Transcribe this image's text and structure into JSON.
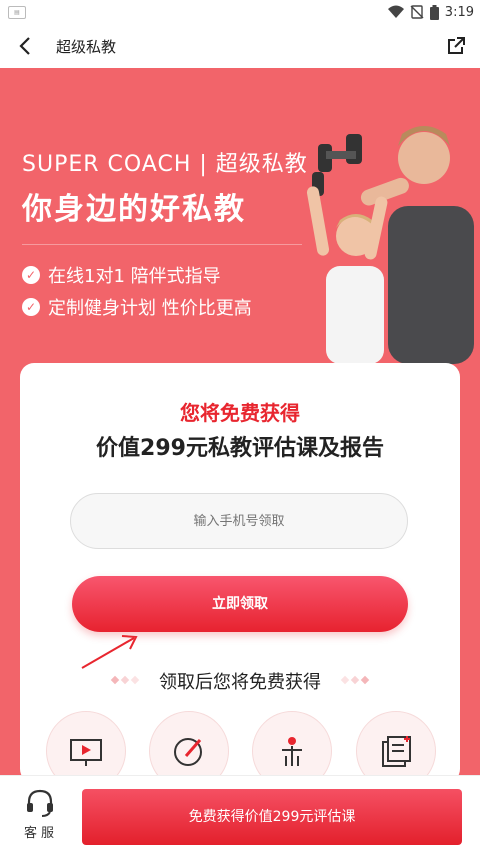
{
  "status_bar": {
    "time": "3:19"
  },
  "header": {
    "title": "超级私教"
  },
  "hero": {
    "super_coach": "SUPER COACH | 超级私教",
    "slogan": "你身边的好私教",
    "features": [
      "在线1对1 陪伴式指导",
      "定制健身计划 性价比更高"
    ]
  },
  "card": {
    "get_free": "您将免费获得",
    "value_line": "价值299元私教评估课及报告",
    "phone_placeholder": "输入手机号领取",
    "claim_button": "立即领取",
    "after_title": "领取后您将免费获得"
  },
  "bottom": {
    "service_label": "客服",
    "cta": "免费获得价值299元评估课"
  },
  "colors": {
    "primary": "#e8262f",
    "hero_bg": "#f2646a"
  }
}
